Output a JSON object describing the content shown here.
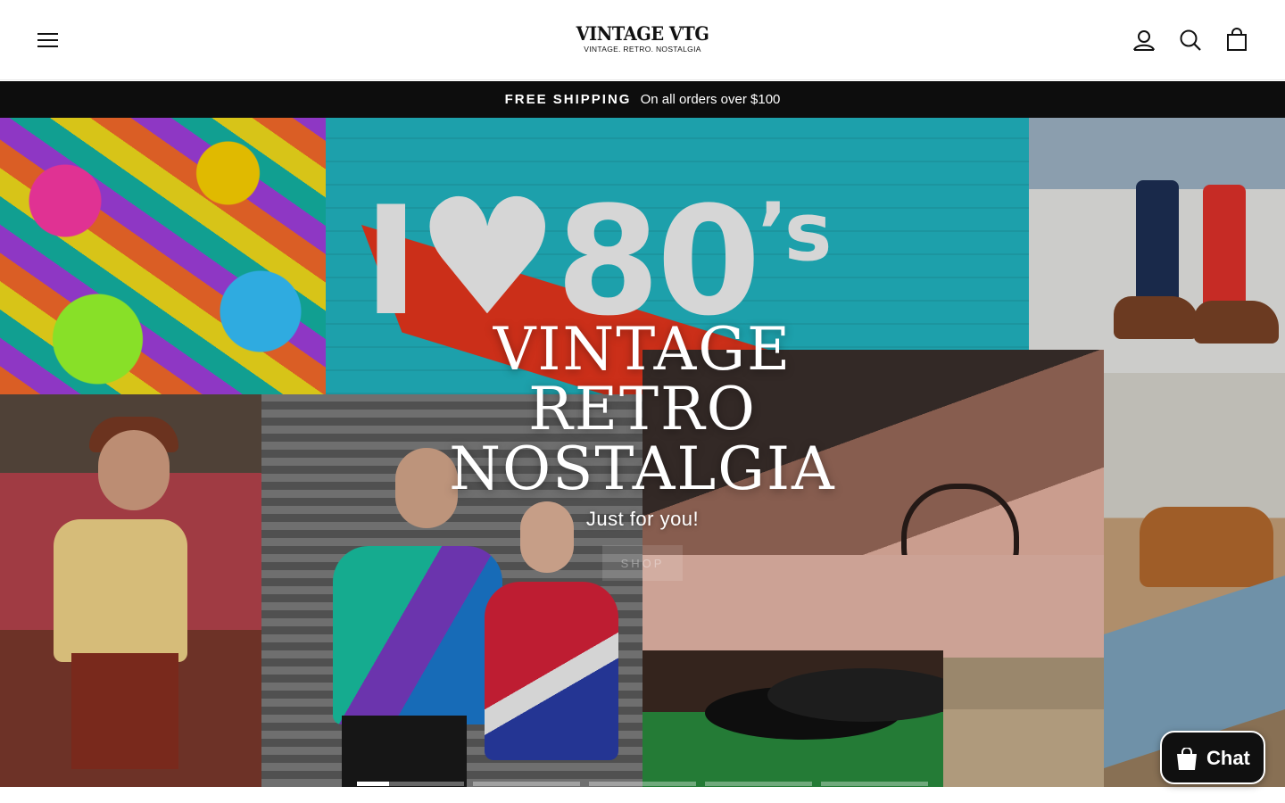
{
  "header": {
    "brand_name": "VINTAGE VTG",
    "brand_tagline": "VINTAGE. RETRO. NOSTALGIA",
    "icons": [
      "menu-icon",
      "account-icon",
      "search-icon",
      "cart-icon"
    ]
  },
  "announcement": {
    "strong": "FREE SHIPPING",
    "text": "On all orders over $100"
  },
  "hero": {
    "title_line1": "VINTAGE",
    "title_line2": "RETRO",
    "title_line3": "NOSTALGIA",
    "subtitle": "Just for you!",
    "button_label": "SHOP"
  },
  "slider": {
    "slide_count": 5,
    "active_index": 0,
    "active_progress": 0.3
  },
  "chat": {
    "label": "Chat"
  },
  "colors": {
    "announcement_bg": "#0d0d0d",
    "chat_bg": "#101010"
  }
}
